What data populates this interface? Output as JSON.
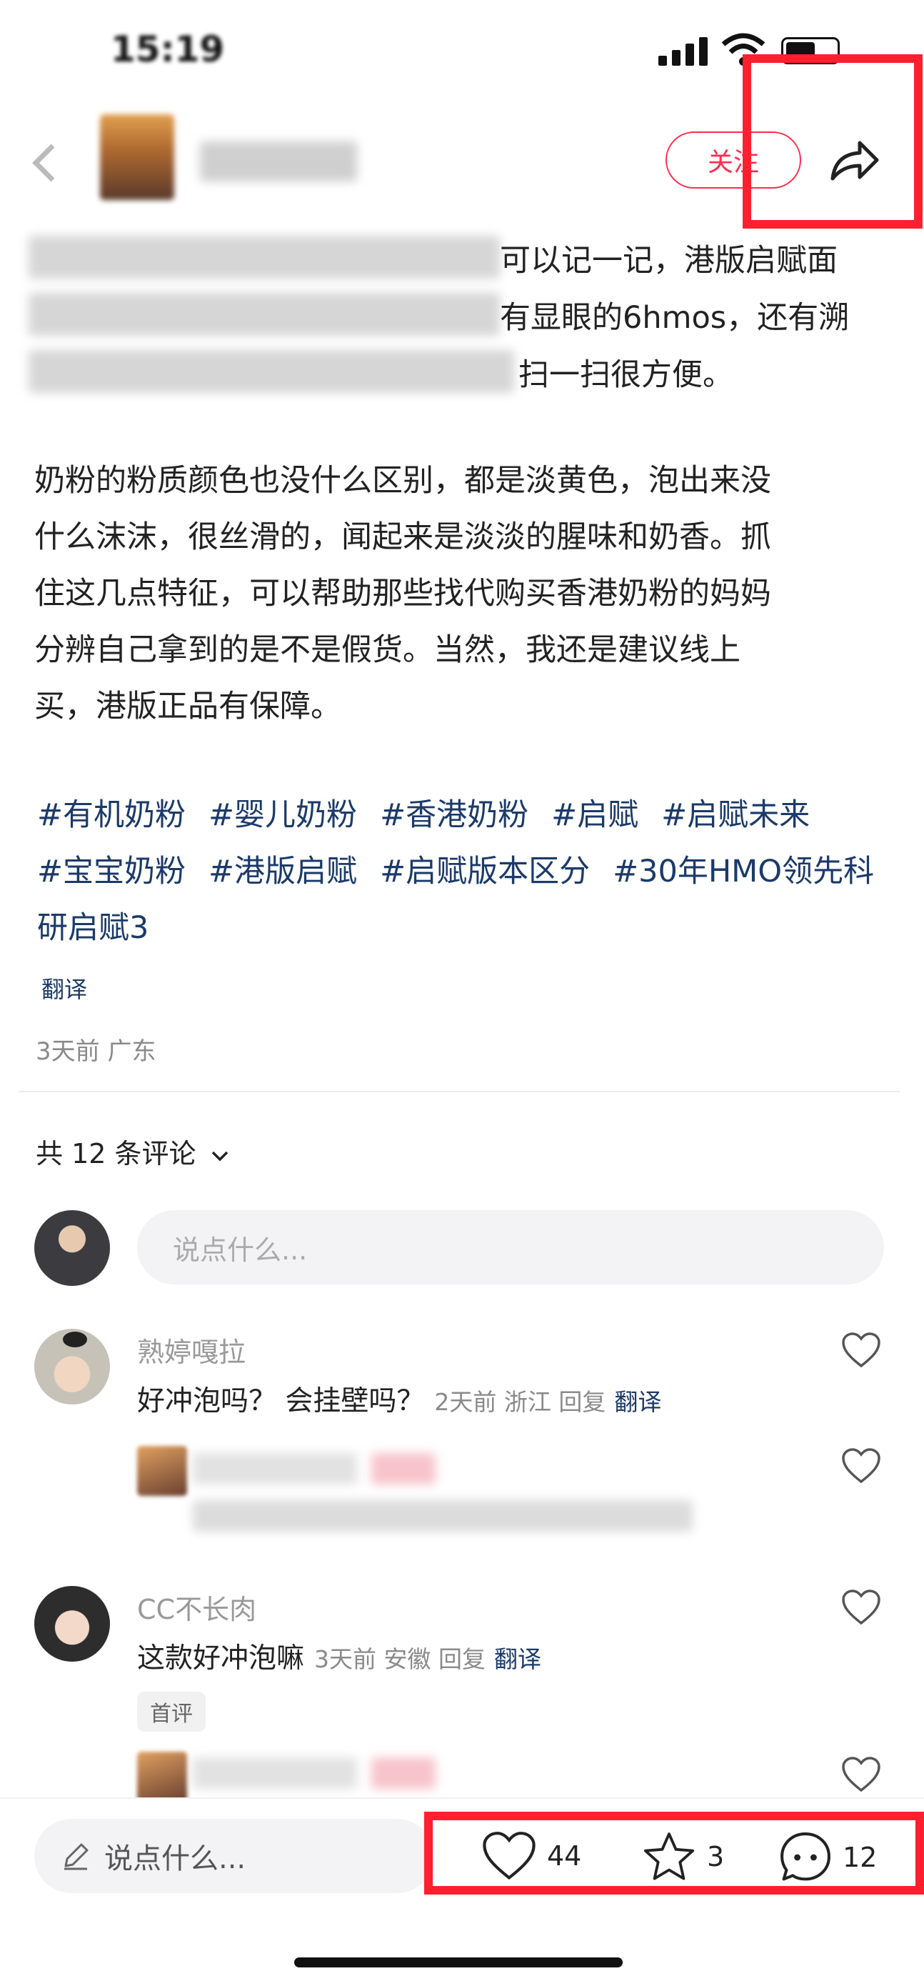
{
  "status_bar": {
    "time": "15:19"
  },
  "header": {
    "follow_label": "关注"
  },
  "post": {
    "para1_visible": [
      "可以记一记，港版启赋面",
      "有显眼的6hmos，还有溯",
      "扫一扫很方便。"
    ],
    "para2": "奶粉的粉质颜色也没什么区别，都是淡黄色，泡出来没\n什么沫沫，很丝滑的，闻起来是淡淡的腥味和奶香。抓\n住这几点特征，可以帮助那些找代购买香港奶粉的妈妈\n分辨自己拿到的是不是假货。当然，我还是建议线上\n买，港版正品有保障。",
    "tags": [
      "#有机奶粉",
      "#婴儿奶粉",
      "#香港奶粉",
      "#启赋",
      "#启赋未来",
      "#宝宝奶粉",
      "#港版启赋",
      "#启赋版本区分",
      "#30年HMO领先科研启赋3"
    ],
    "translate_label": "翻译",
    "meta": "3天前 广东"
  },
  "comments": {
    "count_label": "共 12 条评论",
    "input_placeholder": "说点什么...",
    "items": [
      {
        "name": "熟婷嘎拉",
        "text": "好冲泡吗？ 会挂壁吗？",
        "meta": "2天前 浙江 回复",
        "translate": "翻译"
      },
      {
        "name": "CC不长肉",
        "text": "这款好冲泡嘛",
        "meta": "3天前 安徽 回复",
        "translate": "翻译",
        "badge": "首评"
      }
    ]
  },
  "bottom_bar": {
    "input_placeholder": "说点什么...",
    "likes": "44",
    "stars": "3",
    "comments": "12"
  },
  "colors": {
    "accent_red": "#ff2e4d",
    "tag_blue": "#1b3a6a",
    "highlight_box": "#ff1f2e"
  }
}
